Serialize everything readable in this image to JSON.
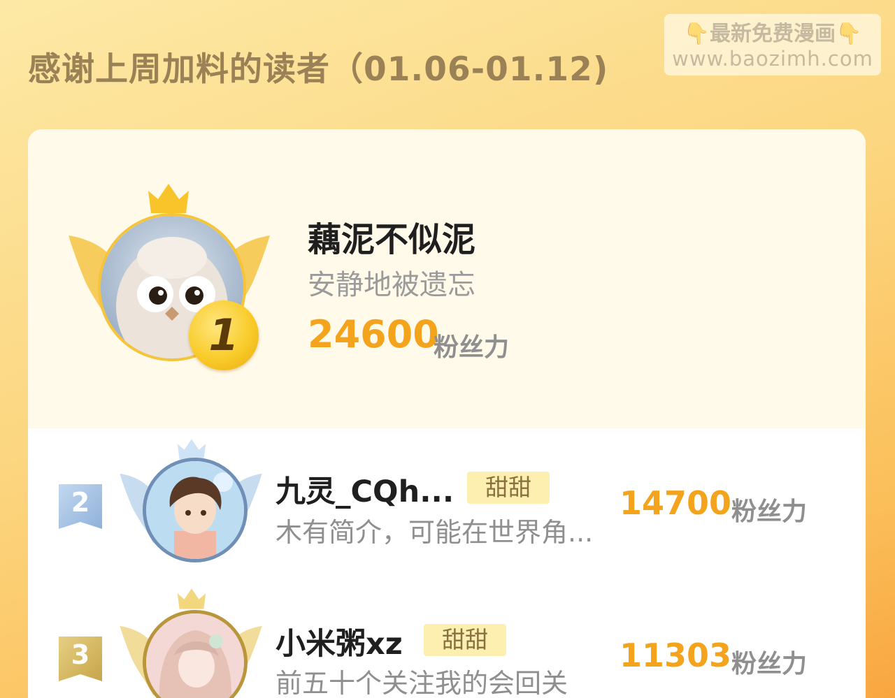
{
  "header": {
    "title": "感谢上周加料的读者（01.06-01.12)"
  },
  "watermark": {
    "line1": "👇最新免费漫画👇",
    "line2": "www.baozimh.com"
  },
  "colors": {
    "accent_score": "#f4a41c",
    "tag_background": "#fdefb0",
    "rank2_badge": "#a8c4e4",
    "rank3_badge": "#d6b860"
  },
  "top_reader": {
    "rank": "1",
    "name": "藕泥不似泥",
    "bio": "安静地被遗忘",
    "score": "24600",
    "score_unit": "粉丝力",
    "icons": [
      "crown-icon",
      "wings-icon",
      "gold-medal-icon"
    ]
  },
  "readers": [
    {
      "rank": "2",
      "name": "九灵_CQh...",
      "tag": "甜甜",
      "bio": "木有简介，可能在世界角...",
      "score": "14700",
      "score_unit": "粉丝力"
    },
    {
      "rank": "3",
      "name": "小米粥xz",
      "tag": "甜甜",
      "bio": "前五十个关注我的会回关",
      "score": "11303",
      "score_unit": "粉丝力"
    }
  ]
}
